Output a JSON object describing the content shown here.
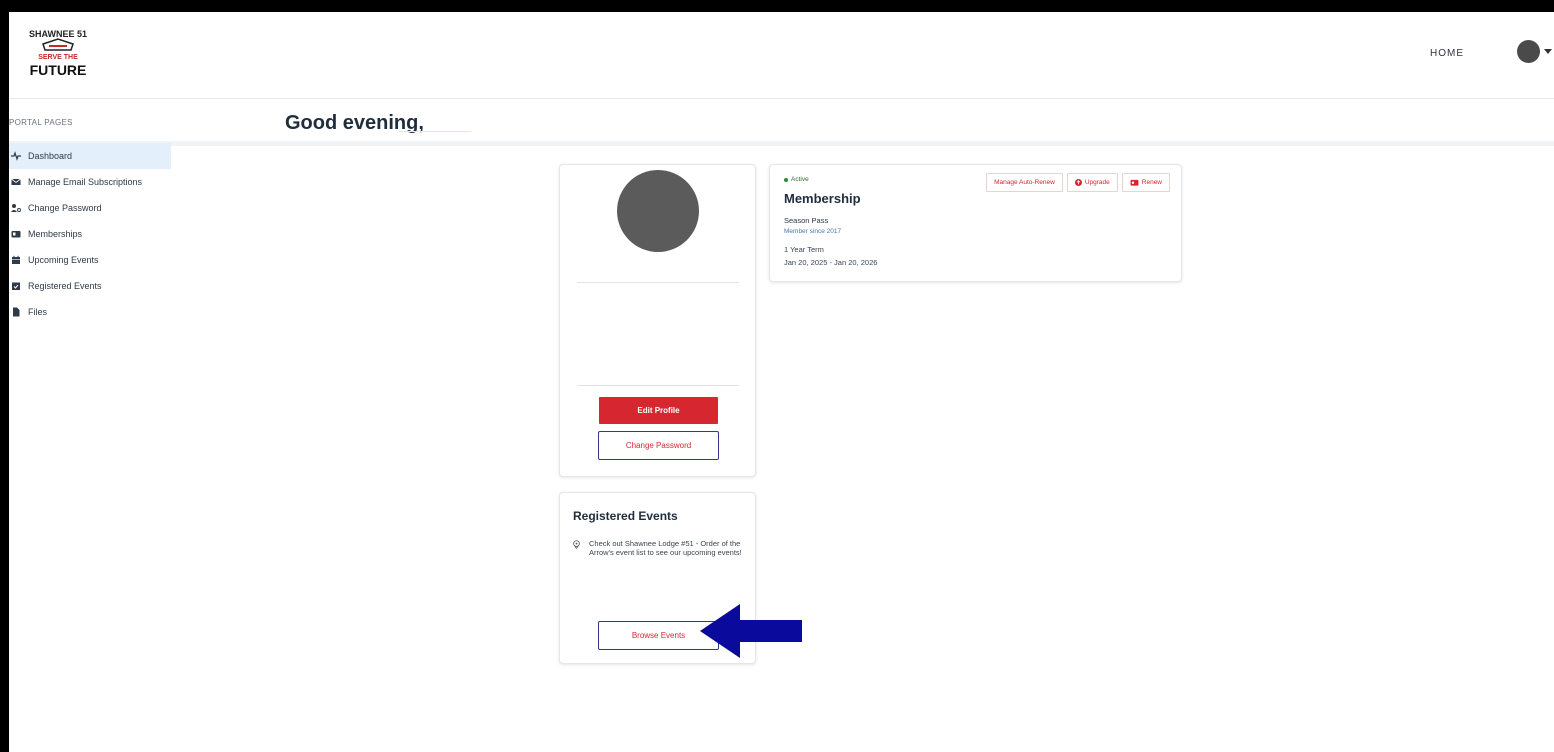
{
  "header": {
    "logo_text_top": "SHAWNEE 51",
    "logo_text_mid": "SERVE THE",
    "logo_text_bottom": "FUTURE",
    "nav_home": "HOME"
  },
  "greeting": "Good evening,",
  "sidebar": {
    "heading": "PORTAL PAGES",
    "items": [
      {
        "label": "Dashboard",
        "icon": "pulse-icon",
        "active": true
      },
      {
        "label": "Manage Email Subscriptions",
        "icon": "envelope-icon"
      },
      {
        "label": "Change Password",
        "icon": "user-key-icon"
      },
      {
        "label": "Memberships",
        "icon": "id-card-icon"
      },
      {
        "label": "Upcoming Events",
        "icon": "calendar-icon"
      },
      {
        "label": "Registered Events",
        "icon": "calendar-check-icon"
      },
      {
        "label": "Files",
        "icon": "file-icon"
      }
    ]
  },
  "profile": {
    "edit_button": "Edit Profile",
    "change_password_button": "Change Password"
  },
  "registered_events": {
    "title": "Registered Events",
    "message": "Check out Shawnee Lodge #51 - Order of the Arrow's event list to see our upcoming events!",
    "browse_button": "Browse Events"
  },
  "membership": {
    "status": "Active",
    "title": "Membership",
    "plan": "Season Pass",
    "member_since": "Member since 2017",
    "term": "1 Year Term",
    "dates": "Jan 20, 2025 - Jan 20, 2026",
    "actions": {
      "auto_renew": "Manage Auto-Renew",
      "upgrade": "Upgrade",
      "renew": "Renew"
    }
  },
  "colors": {
    "brand_red": "#d62630",
    "arrow_blue": "#0a0a9c",
    "active_highlight": "#e3f0fb"
  }
}
